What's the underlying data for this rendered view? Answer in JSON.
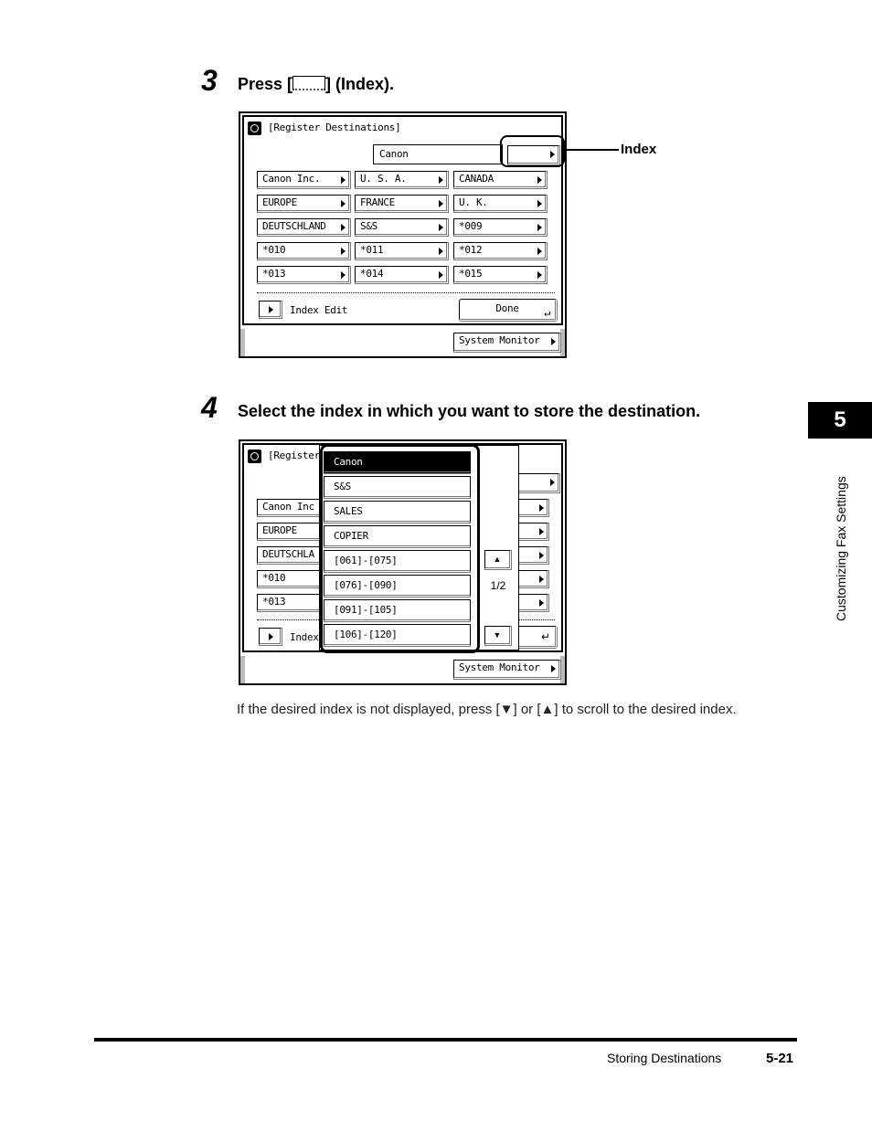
{
  "step3": {
    "number": "3",
    "prefix": "Press [",
    "suffix": "] (Index).",
    "screen": {
      "title": "[Register Destinations]",
      "index_field_value": "Canon",
      "index_button_label": "",
      "callout_label": "Index",
      "destinations": [
        "Canon Inc.",
        "U. S. A.",
        "CANADA",
        "EUROPE",
        "FRANCE",
        "U. K.",
        "DEUTSCHLAND",
        "S&S",
        "*009",
        "*010",
        "*011",
        "*012",
        "*013",
        "*014",
        "*015"
      ],
      "index_edit_label": "Index Edit",
      "done_label": "Done",
      "system_monitor_label": "System Monitor"
    }
  },
  "step4": {
    "number": "4",
    "text": "Select the index in which you want to store the destination.",
    "screen": {
      "title_partial": "[Register",
      "left_buttons": [
        "Canon Inc",
        "EUROPE",
        "DEUTSCHLA",
        "*010",
        "*013"
      ],
      "index_partial": "Index",
      "popup_items": [
        "Canon",
        "S&S",
        "SALES",
        "COPIER",
        "[061]-[075]",
        "[076]-[090]",
        "[091]-[105]",
        "[106]-[120]"
      ],
      "selected_item": "Canon",
      "page_indicator": "1/2",
      "scroll_up_icon": "▲",
      "scroll_down_icon": "▼",
      "system_monitor_label": "System Monitor"
    },
    "note": "If the desired index is not displayed, press [▼] or [▲] to scroll to the desired index."
  },
  "side_tab": {
    "chapter": "5",
    "label": "Customizing Fax Settings"
  },
  "footer": {
    "section": "Storing Destinations",
    "page": "5-21"
  }
}
